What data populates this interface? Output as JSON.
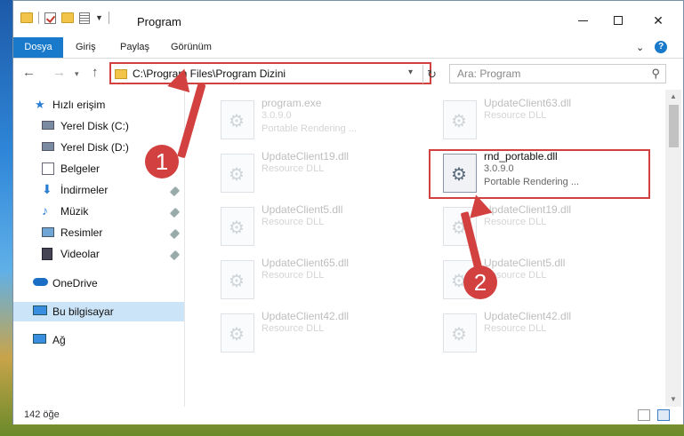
{
  "window": {
    "title": "Program"
  },
  "ribbon": {
    "tabs": [
      "Dosya",
      "Giriş",
      "Paylaş",
      "Görünüm"
    ]
  },
  "address": {
    "path": "C:\\Program Files\\Program Dizini"
  },
  "search": {
    "placeholder": "Ara: Program"
  },
  "nav": {
    "items": [
      {
        "label": "Hızlı erişim",
        "icon": "star-icon"
      },
      {
        "label": "Yerel Disk (C:)",
        "icon": "drive-icon"
      },
      {
        "label": "Yerel Disk (D:)",
        "icon": "drive-icon"
      },
      {
        "label": "Belgeler",
        "icon": "documents-icon"
      },
      {
        "label": "İndirmeler",
        "icon": "download-icon"
      },
      {
        "label": "Müzik",
        "icon": "music-icon"
      },
      {
        "label": "Resimler",
        "icon": "pictures-icon"
      },
      {
        "label": "Videolar",
        "icon": "video-icon"
      },
      {
        "label": "OneDrive",
        "icon": "cloud-icon"
      },
      {
        "label": "Bu bilgisayar",
        "icon": "computer-icon"
      },
      {
        "label": "Ağ",
        "icon": "network-icon"
      }
    ]
  },
  "files": [
    {
      "name": "program.exe",
      "line1": "3.0.9.0",
      "line2": "Portable Rendering ..."
    },
    {
      "name": "UpdateClient63.dll",
      "line1": "Resource DLL",
      "line2": ""
    },
    {
      "name": "UpdateClient19.dll",
      "line1": "Resource DLL",
      "line2": ""
    },
    {
      "name": "rnd_portable.dll",
      "line1": "3.0.9.0",
      "line2": "Portable Rendering ..."
    },
    {
      "name": "UpdateClient5.dll",
      "line1": "Resource DLL",
      "line2": ""
    },
    {
      "name": "UpdateClient19.dll",
      "line1": "Resource DLL",
      "line2": ""
    },
    {
      "name": "UpdateClient65.dll",
      "line1": "Resource DLL",
      "line2": ""
    },
    {
      "name": "UpdateClient5.dll",
      "line1": "Resource DLL",
      "line2": ""
    },
    {
      "name": "UpdateClient42.dll",
      "line1": "Resource DLL",
      "line2": ""
    },
    {
      "name": "UpdateClient42.dll",
      "line1": "Resource DLL",
      "line2": ""
    }
  ],
  "status": {
    "count": "142 öğe"
  },
  "annotations": {
    "step1": "1",
    "step2": "2",
    "color": "#d24040"
  }
}
